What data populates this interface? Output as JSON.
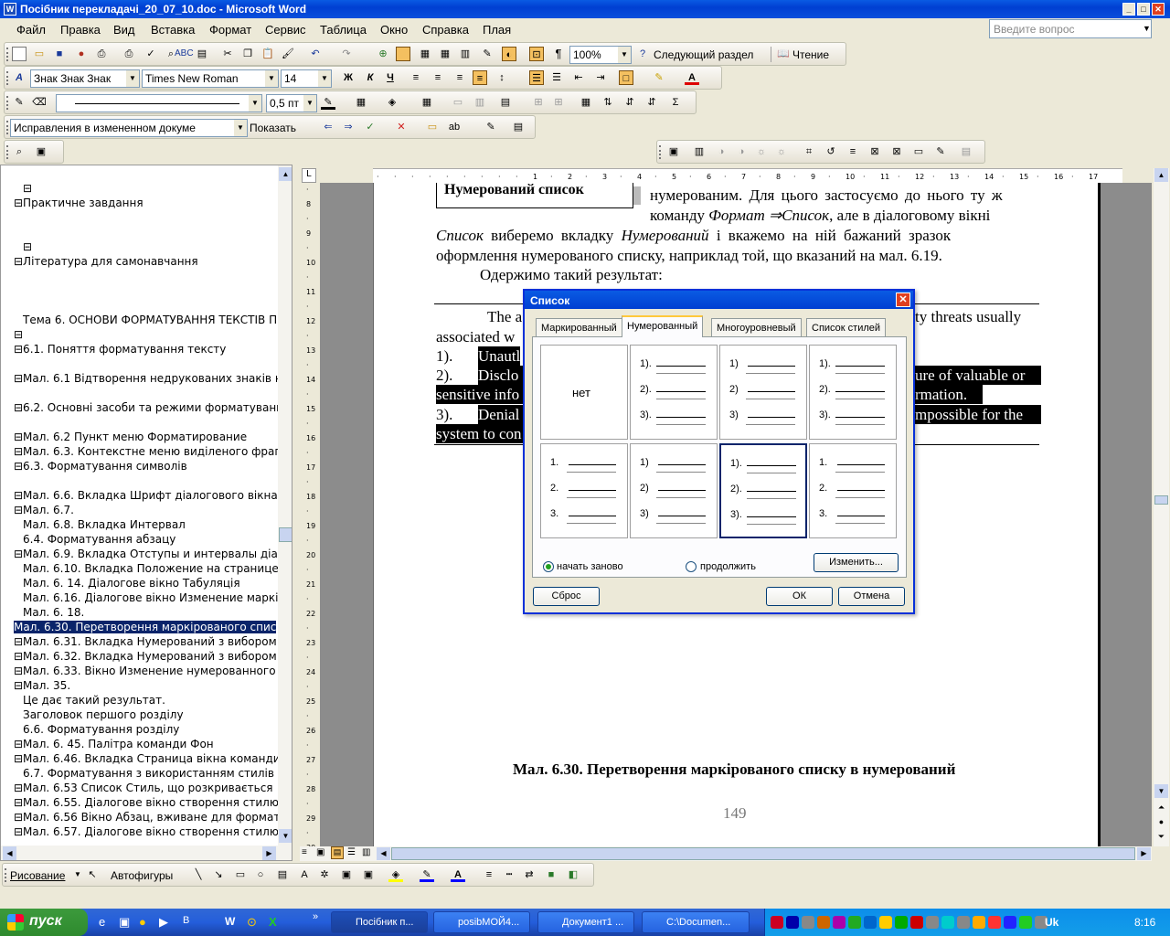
{
  "window": {
    "title": "Посібник перекладачі_20_07_10.doc - Microsoft Word"
  },
  "menu": {
    "items": [
      "Файл",
      "Правка",
      "Вид",
      "Вставка",
      "Формат",
      "Сервис",
      "Таблица",
      "Окно",
      "Справка",
      "Плая"
    ],
    "ask_placeholder": "Введите вопрос"
  },
  "toolbar1": {
    "zoom": "100%",
    "next_section": "Следующий раздел",
    "reading": "Чтение"
  },
  "toolbar2": {
    "style": "Знак Знак Знак",
    "font": "Times New Roman",
    "size": "14"
  },
  "toolbar3": {
    "line_weight": "0,5 пт"
  },
  "toolbar4": {
    "track_changes": "Исправления в измененном докуме",
    "show": "Показать"
  },
  "docmap": {
    "items": [
      {
        "text": "⊟",
        "indent": 1
      },
      {
        "text": "⊟Практичне завдання",
        "indent": 0
      },
      {
        "text": "⊟",
        "indent": 1
      },
      {
        "text": "⊟Література для самонавчання",
        "indent": 0
      },
      {
        "text": "Тема 6. ОСНОВИ ФОРМАТУВАННЯ ТЕКСТІВ П",
        "indent": 1
      },
      {
        "text": "⊟",
        "indent": 0
      },
      {
        "text": "⊟6.1. Поняття форматування тексту",
        "indent": 0
      },
      {
        "text": "⊟Мал. 6.1 Відтворення недрукованих знаків на",
        "indent": 0
      },
      {
        "text": "⊟6.2. Основні  засоби та режими форматуванн",
        "indent": 0
      },
      {
        "text": "⊟Мал. 6.2 Пункт меню Форматирование",
        "indent": 0
      },
      {
        "text": "⊟Мал. 6.3. Контекстне меню виділеного фрагм",
        "indent": 0
      },
      {
        "text": "⊟6.3. Форматування символів",
        "indent": 0
      },
      {
        "text": "⊟Мал. 6.6. Вкладка Шрифт діалогового вікна Ц",
        "indent": 0
      },
      {
        "text": "⊟Мал. 6.7.",
        "indent": 0
      },
      {
        "text": "Мал. 6.8. Вкладка Интервал",
        "indent": 1
      },
      {
        "text": "6.4. Форматування абзацу",
        "indent": 1
      },
      {
        "text": "⊟Мал. 6.9. Вкладка Отступы и интервалы діало",
        "indent": 0
      },
      {
        "text": "Мал. 6.10. Вкладка Положение на странице д",
        "indent": 1
      },
      {
        "text": "Мал. 6. 14. Діалогове вікно   Табуляція",
        "indent": 1
      },
      {
        "text": "Мал. 6.16. Діалогове вікно Изменение маркір",
        "indent": 1
      },
      {
        "text": "Мал. 6. 18.",
        "indent": 1
      },
      {
        "text": "Мал. 6.30. Перетворення маркірованого спис",
        "indent": 0,
        "selected": true
      },
      {
        "text": "⊟Мал. 6.31. Вкладка Нумерований з вибором",
        "indent": 0
      },
      {
        "text": "⊟Мал. 6.32. Вкладка Нумерований з вибором",
        "indent": 0
      },
      {
        "text": "⊟Мал. 6.33. Вікно Изменение нумерованного с",
        "indent": 0
      },
      {
        "text": "⊟Мал. 35.",
        "indent": 0
      },
      {
        "text": "Це дає такий результат.",
        "indent": 1
      },
      {
        "text": "Заголовок першого розділу",
        "indent": 1
      },
      {
        "text": "6.6. Форматування розділу",
        "indent": 1
      },
      {
        "text": "⊟Мал. 6. 45. Палітра команди Фон",
        "indent": 0
      },
      {
        "text": "⊟Мал. 6.46. Вкладка Страница вікна команди Г",
        "indent": 0
      },
      {
        "text": "6.7. Форматування  з використанням стилів",
        "indent": 1
      },
      {
        "text": "⊟Мал. 6.53 Список Стиль, що розкривається",
        "indent": 0
      },
      {
        "text": "⊟Мал. 6.55. Діалогове вікно створення стилю з",
        "indent": 0
      },
      {
        "text": "⊟Мал. 6.56 Вікно Абзац, вживане для формату",
        "indent": 0
      },
      {
        "text": "⊟Мал. 6.57. Діалогове вікно створення стилю",
        "indent": 0
      }
    ]
  },
  "document": {
    "box_heading": "Нумерований список",
    "p1a": "нумерованим. Для цього застосуємо до нього ту ж",
    "p1b_pre": "команду ",
    "p1b_italic": "Формат ⇒Список",
    "p1b_post": ", але в діалоговому вікні",
    "p1c_italic1": "Список",
    "p1c_mid": " виберемо вкладку ",
    "p1c_italic2": "Нумерований",
    "p1c_post": " і вкажемо на ній бажаний зразок",
    "p1d": "оформлення нумерованого списку, наприклад той, що вказаний на мал. 6.19.",
    "p2": "Одержимо такий результат:",
    "e1a": "The a",
    "e1b": "ty threats usually",
    "e2": "associated w",
    "l1num": "1).",
    "l1": "Unautl",
    "l2num": "2).",
    "l2a": "Disclo",
    "l2b": "ure of valuable or",
    "l2c": "sensitive info",
    "l2d": "rmation.",
    "l3num": "3).",
    "l3a": "Denial",
    "l3b": "mpossible for the",
    "l3c": "system to con",
    "caption": "Мал. 6.30. Перетворення маркірованого списку в нумерований",
    "page_number": "149"
  },
  "dialog": {
    "title": "Список",
    "tabs": [
      "Маркированный",
      "Нумерованный",
      "Многоуровневый",
      "Список стилей"
    ],
    "none_label": "нет",
    "patterns": [
      [
        "1).",
        "2).",
        "3)."
      ],
      [
        "1)",
        "2)",
        "3)"
      ],
      [
        "1).",
        "2).",
        "3)."
      ],
      [
        "1.",
        "2.",
        "3."
      ],
      [
        "1)",
        "2)",
        "3)"
      ],
      [
        "1).",
        "2).",
        "3)."
      ],
      [
        "1.",
        "2.",
        "3."
      ]
    ],
    "radio_restart": "начать заново",
    "radio_continue": "продолжить",
    "change_btn": "Изменить...",
    "reset_btn": "Сброс",
    "ok_btn": "ОК",
    "cancel_btn": "Отмена"
  },
  "drawing": {
    "draw": "Рисование",
    "autoshapes": "Автофигуры"
  },
  "taskbar": {
    "start": "пуск",
    "tasks": [
      "Посібник п...",
      "posibМОЙ4...",
      "Документ1 ...",
      "C:\\Documen..."
    ],
    "clock": "8:16",
    "lang": "Uk"
  }
}
